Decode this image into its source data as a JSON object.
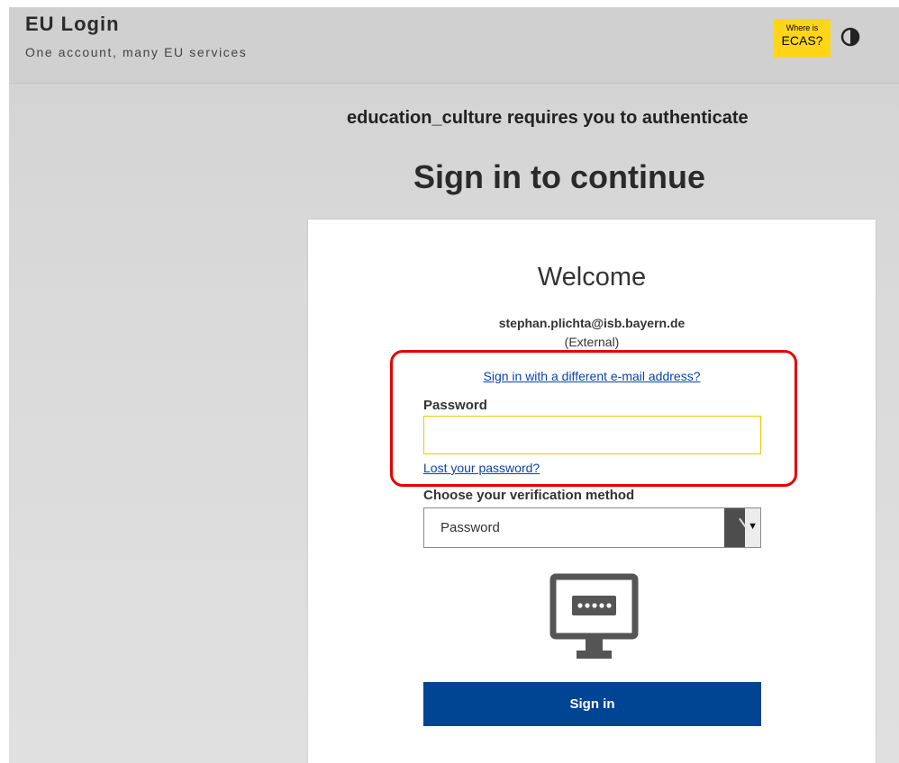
{
  "header": {
    "title": "EU Login",
    "subtitle": "One account, many EU services",
    "ecas_badge": {
      "line1": "Where is",
      "line2": "ECAS?",
      "color": "#ffd617"
    },
    "contrast_icon": "contrast-icon"
  },
  "main": {
    "requirement": "education_culture requires you to authenticate",
    "heading": "Sign in to continue"
  },
  "card": {
    "welcome": "Welcome",
    "email": "stephan.plichta@isb.bayern.de",
    "account_type": "(External)",
    "different_email_link": "Sign in with a different e-mail address?",
    "password_label": "Password",
    "password_value": "",
    "lost_password_link": "Lost your password?",
    "verification_label": "Choose your verification method",
    "verification_selected": "Password",
    "verification_icon": "monitor-password-icon",
    "sign_in_button": "Sign in",
    "highlight_color": "#e60000",
    "button_color": "#004494"
  }
}
